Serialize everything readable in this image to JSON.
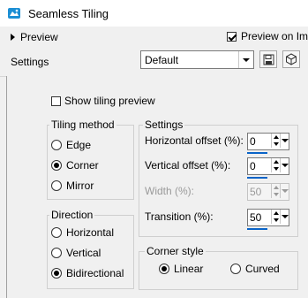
{
  "window": {
    "title": "Seamless Tiling"
  },
  "header": {
    "preview_label": "Preview",
    "preview_on_image_label": "Preview on Ima",
    "preview_on_image_checked": true
  },
  "settings": {
    "label": "Settings",
    "preset_value": "Default"
  },
  "options": {
    "show_tiling_preview_label": "Show tiling preview",
    "show_tiling_preview_checked": false
  },
  "tiling_method": {
    "title": "Tiling method",
    "options": [
      "Edge",
      "Corner",
      "Mirror"
    ],
    "selected": "Corner"
  },
  "direction": {
    "title": "Direction",
    "options": [
      "Horizontal",
      "Vertical",
      "Bidirectional"
    ],
    "selected": "Bidirectional"
  },
  "settings_group": {
    "title": "Settings",
    "horizontal_offset_label": "Horizontal offset (%):",
    "horizontal_offset_value": "0",
    "vertical_offset_label": "Vertical offset (%):",
    "vertical_offset_value": "0",
    "width_label": "Width (%):",
    "width_value": "50",
    "transition_label": "Transition (%):",
    "transition_value": "50"
  },
  "corner_style": {
    "title": "Corner style",
    "options": [
      "Linear",
      "Curved"
    ],
    "selected": "Linear"
  },
  "colors": {
    "accent": "#0a64c8",
    "app_icon": "#1c8fd4"
  }
}
